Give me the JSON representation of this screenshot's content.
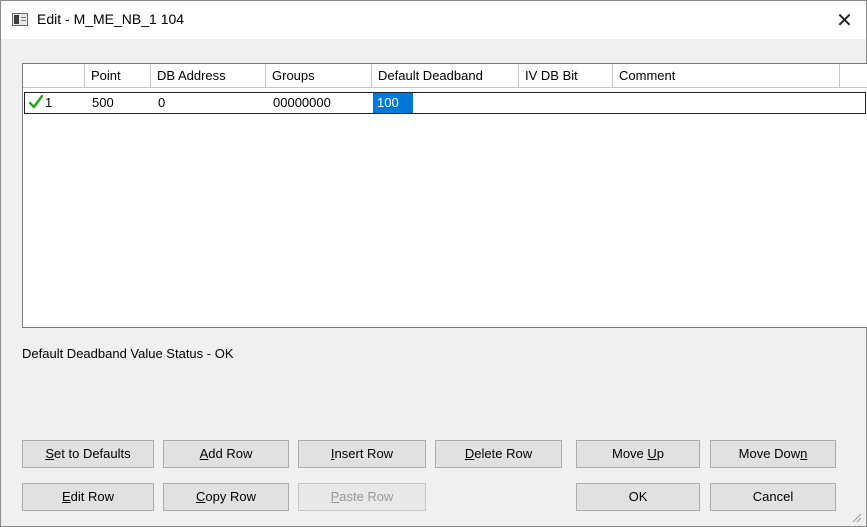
{
  "window": {
    "title": "Edit - M_ME_NB_1 104",
    "close_glyph": "✕"
  },
  "grid": {
    "columns": [
      "",
      "Point",
      "DB Address",
      "Groups",
      "Default Deadband",
      "IV DB Bit",
      "Comment"
    ],
    "rows": [
      {
        "row_label": "1",
        "status_icon": "checkmark-icon",
        "point": "500",
        "db_address": "0",
        "groups": "00000000",
        "default_deadband": "100",
        "iv_db_bit": "",
        "comment": ""
      }
    ],
    "selected_cell_color": "#0078d7",
    "check_color": "#22a022"
  },
  "status": {
    "text": "Default Deadband Value Status - OK"
  },
  "buttons": {
    "set_defaults": {
      "pre": "",
      "u": "S",
      "post": "et to Defaults"
    },
    "add_row": {
      "pre": "",
      "u": "A",
      "post": "dd Row"
    },
    "insert_row": {
      "pre": "",
      "u": "I",
      "post": "nsert Row"
    },
    "delete_row": {
      "pre": "",
      "u": "D",
      "post": "elete Row"
    },
    "move_up": {
      "pre": "Move ",
      "u": "U",
      "post": "p"
    },
    "move_down": {
      "pre": "Move Dow",
      "u": "n",
      "post": ""
    },
    "edit_row": {
      "pre": "",
      "u": "E",
      "post": "dit Row"
    },
    "copy_row": {
      "pre": "",
      "u": "C",
      "post": "opy Row"
    },
    "paste_row": {
      "pre": "",
      "u": "P",
      "post": "aste Row"
    },
    "ok": {
      "pre": "OK",
      "u": "",
      "post": ""
    },
    "cancel": {
      "pre": "Cancel",
      "u": "",
      "post": ""
    }
  }
}
